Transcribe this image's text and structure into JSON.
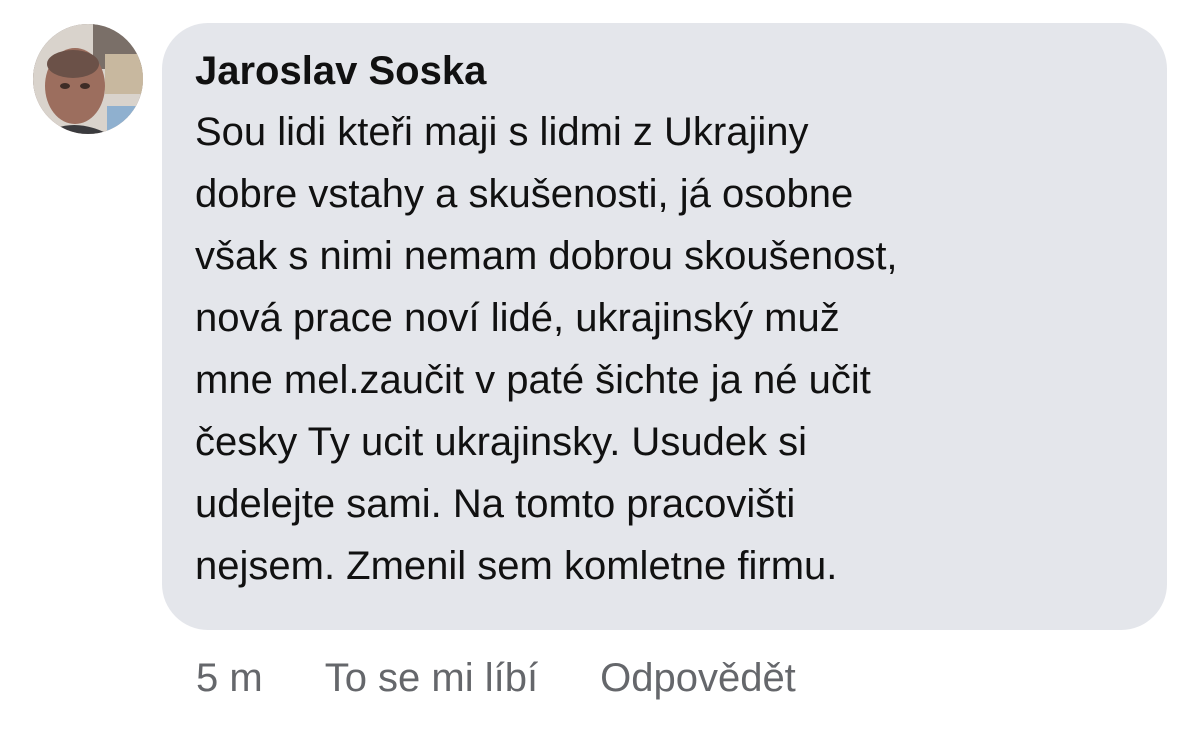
{
  "comment": {
    "author": "Jaroslav Soska",
    "lines": [
      "Sou lidi kteři maji s lidmi z Ukrajiny",
      "dobre vstahy a skušenosti, já osobne",
      "však s nimi nemam dobrou skoušenost,",
      "nová prace noví lidé, ukrajinský muž",
      "mne mel.zaučit v paté šichte ja né učit",
      "česky Ty ucit ukrajinsky. Usudek si",
      "udelejte sami. Na tomto pracovišti",
      "nejsem. Zmenil sem komletne firmu."
    ]
  },
  "actions": {
    "timestamp": "5 m",
    "like_label": "To se mi líbí",
    "reply_label": "Odpovědět"
  },
  "colors": {
    "bubble": "#e4e6eb",
    "text": "#111111",
    "meta": "#65676b"
  }
}
